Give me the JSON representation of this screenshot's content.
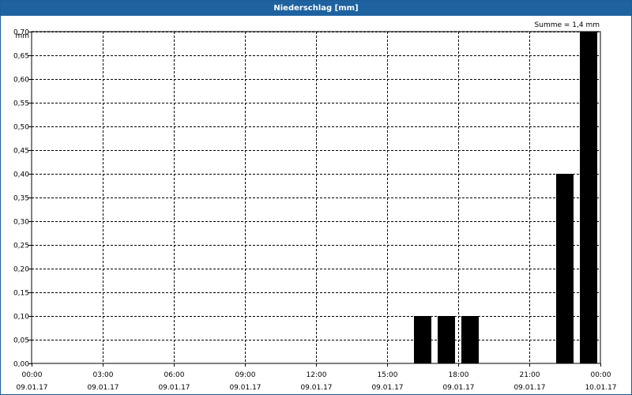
{
  "header": {
    "title": "Niederschlag [mm]"
  },
  "summary": {
    "text": "Summe = 1,4 mm"
  },
  "colors": {
    "titlebar": "#1e62a0",
    "bars": "#000000",
    "grid": "#000000"
  },
  "chart_data": {
    "type": "bar",
    "title": "Niederschlag [mm]",
    "ylabel": "mm",
    "ylim": [
      0,
      0.7
    ],
    "y_ticks": [
      "0,00",
      "0,05",
      "0,10",
      "0,15",
      "0,20",
      "0,25",
      "0,30",
      "0,35",
      "0,40",
      "0,45",
      "0,50",
      "0,55",
      "0,60",
      "0,65",
      "0,70"
    ],
    "x_ticks": [
      {
        "time": "00:00",
        "date": "09.01.17"
      },
      {
        "time": "03:00",
        "date": "09.01.17"
      },
      {
        "time": "06:00",
        "date": "09.01.17"
      },
      {
        "time": "09:00",
        "date": "09.01.17"
      },
      {
        "time": "12:00",
        "date": "09.01.17"
      },
      {
        "time": "15:00",
        "date": "09.01.17"
      },
      {
        "time": "18:00",
        "date": "09.01.17"
      },
      {
        "time": "21:00",
        "date": "09.01.17"
      },
      {
        "time": "00:00",
        "date": "10.01.17"
      }
    ],
    "xlim": [
      "09.01.17 00:00",
      "10.01.17 00:00"
    ],
    "grid": true,
    "bars": [
      {
        "time": "09.01.17 16:30",
        "value": 0.1
      },
      {
        "time": "09.01.17 17:30",
        "value": 0.1
      },
      {
        "time": "09.01.17 18:30",
        "value": 0.1
      },
      {
        "time": "09.01.17 22:30",
        "value": 0.4
      },
      {
        "time": "09.01.17 23:30",
        "value": 0.7
      }
    ]
  }
}
